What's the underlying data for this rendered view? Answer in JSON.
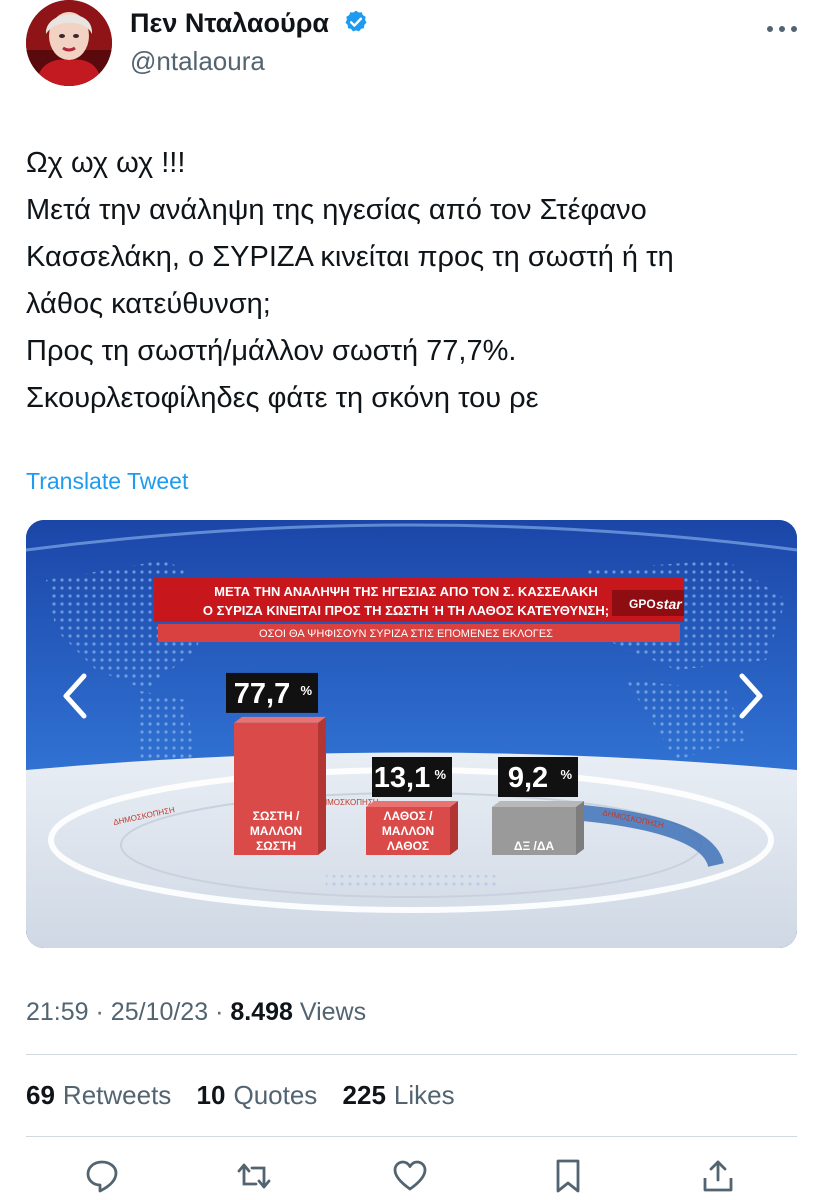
{
  "tweet": {
    "display_name": "Πεν Νταλαούρα",
    "handle": "@ntalaoura",
    "text_lines": [
      "Ωχ ωχ ωχ !!!",
      "Μετά την ανάληψη της ηγεσίας από τον Στέφανο",
      "Κασσελάκη, ο ΣΥΡΙΖΑ κινείται προς τη σωστή ή τη",
      "λάθος κατεύθυνση;",
      "Προς τη σωστή/μάλλον σωστή 77,7%.",
      "Σκουρλετοφίληδες φάτε τη σκόνη του ρε"
    ],
    "translate_label": "Translate Tweet",
    "time": "21:59",
    "date": "25/10/23",
    "views_count": "8.498",
    "views_label": "Views",
    "retweets_count": "69",
    "retweets_label": "Retweets",
    "quotes_count": "10",
    "quotes_label": "Quotes",
    "likes_count": "225",
    "likes_label": "Likes",
    "meta_sep": "·"
  },
  "media": {
    "headline_line1": "ΜΕΤΑ ΤΗΝ ΑΝΑΛΗΨΗ ΤΗΣ ΗΓΕΣΙΑΣ ΑΠΟ ΤΟΝ Σ. ΚΑΣΣΕΛΑΚΗ",
    "headline_line2": "Ο ΣΥΡΙΖΑ ΚΙΝΕΙΤΑΙ ΠΡΟΣ ΤΗ ΣΩΣΤΗ Ή ΤΗ ΛΑΘΟΣ ΚΑΤΕΥΘΥΝΣΗ;",
    "logo_gpo": "GPO",
    "logo_star": "star",
    "subheadline": "ΟΣΟΙ ΘΑ ΨΗΦΙΣΟΥΝ ΣΥΡΙΖΑ ΣΤΙΣ ΕΠΟΜΕΝΕΣ ΕΚΛΟΓΕΣ",
    "watermark": "ΔΗΜΟΣΚΟΠΗΣΗ",
    "percent_sign": "%",
    "bars": [
      {
        "value_label": "77,7",
        "value": 77.7,
        "label_lines": [
          "ΣΩΣΤΗ /",
          "ΜΑΛΛΟΝ",
          "ΣΩΣΤΗ"
        ],
        "color": "#d94a48"
      },
      {
        "value_label": "13,1",
        "value": 13.1,
        "label_lines": [
          "ΛΑΘΟΣ /",
          "ΜΑΛΛΟΝ",
          "ΛΑΘΟΣ"
        ],
        "color": "#d94a48"
      },
      {
        "value_label": "9,2",
        "value": 9.2,
        "label_lines": [
          "ΔΞ /ΔΑ"
        ],
        "color": "#9a9a9a"
      }
    ]
  },
  "colors": {
    "accent": "#1d9bf0",
    "headline_red": "#c8161d",
    "bar_red": "#d94a48",
    "bar_gray": "#9a9a9a"
  },
  "icons": [
    "verified-badge-icon",
    "more-options-icon",
    "chevron-left-icon",
    "chevron-right-icon",
    "reply-icon",
    "retweet-icon",
    "like-icon",
    "bookmark-icon",
    "share-icon"
  ]
}
